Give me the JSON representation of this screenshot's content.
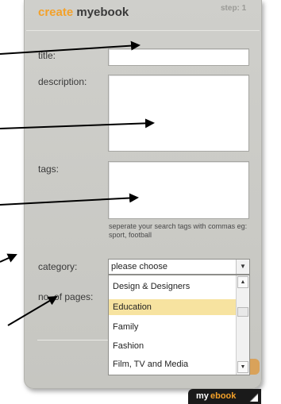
{
  "header": {
    "title_part1": "create",
    "title_part2": "myebook",
    "step": "step: 1"
  },
  "form": {
    "title_label": "title:",
    "title_value": "",
    "description_label": "description:",
    "description_value": "",
    "tags_label": "tags:",
    "tags_value": "",
    "tags_hint": "seperate your search tags with commas eg: sport, football",
    "category_label": "category:",
    "category_selected": "please choose",
    "pages_label": "no. of  pages:"
  },
  "dropdown": {
    "items": [
      "Design & Designers",
      "Education",
      "Family",
      "Fashion",
      "Film, TV and Media"
    ],
    "highlighted": "Education"
  },
  "footer": {
    "logo_my": "my",
    "logo_ebook": "ebook"
  },
  "icons": {
    "dropdown_arrow": "chevron-down-icon",
    "scroll_up": "chevron-up-icon",
    "scroll_down": "chevron-down-icon",
    "annotation_arrows": "arrow-right-icon"
  },
  "colors": {
    "accent": "#f3a12a",
    "panel": "#cbcbc6",
    "highlight": "#f7e3a0"
  }
}
